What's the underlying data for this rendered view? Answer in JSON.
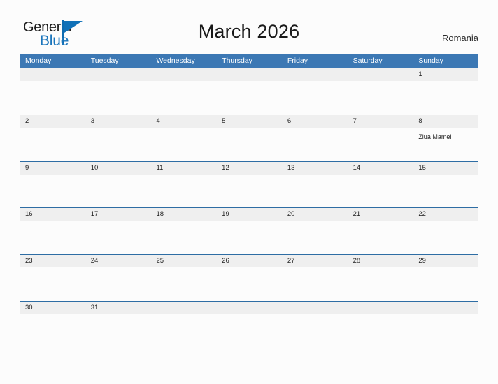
{
  "brand": {
    "word_one": "General",
    "word_two": "Blue",
    "flag_icon": "blue-triangle-flag",
    "color_dark": "#1a1a1a",
    "color_blue": "#1b75bb"
  },
  "header": {
    "title": "March 2026",
    "country": "Romania"
  },
  "theme": {
    "header_bar": "#3c78b4",
    "row_divider": "#2e6da4",
    "date_band": "#efefef",
    "page_background": "#fcfcfc"
  },
  "calendar": {
    "weekdays": [
      "Monday",
      "Tuesday",
      "Wednesday",
      "Thursday",
      "Friday",
      "Saturday",
      "Sunday"
    ],
    "weeks": [
      {
        "days": [
          {
            "date": "",
            "event": ""
          },
          {
            "date": "",
            "event": ""
          },
          {
            "date": "",
            "event": ""
          },
          {
            "date": "",
            "event": ""
          },
          {
            "date": "",
            "event": ""
          },
          {
            "date": "",
            "event": ""
          },
          {
            "date": "1",
            "event": ""
          }
        ]
      },
      {
        "days": [
          {
            "date": "2",
            "event": ""
          },
          {
            "date": "3",
            "event": ""
          },
          {
            "date": "4",
            "event": ""
          },
          {
            "date": "5",
            "event": ""
          },
          {
            "date": "6",
            "event": ""
          },
          {
            "date": "7",
            "event": ""
          },
          {
            "date": "8",
            "event": "Ziua Mamei"
          }
        ]
      },
      {
        "days": [
          {
            "date": "9",
            "event": ""
          },
          {
            "date": "10",
            "event": ""
          },
          {
            "date": "11",
            "event": ""
          },
          {
            "date": "12",
            "event": ""
          },
          {
            "date": "13",
            "event": ""
          },
          {
            "date": "14",
            "event": ""
          },
          {
            "date": "15",
            "event": ""
          }
        ]
      },
      {
        "days": [
          {
            "date": "16",
            "event": ""
          },
          {
            "date": "17",
            "event": ""
          },
          {
            "date": "18",
            "event": ""
          },
          {
            "date": "19",
            "event": ""
          },
          {
            "date": "20",
            "event": ""
          },
          {
            "date": "21",
            "event": ""
          },
          {
            "date": "22",
            "event": ""
          }
        ]
      },
      {
        "days": [
          {
            "date": "23",
            "event": ""
          },
          {
            "date": "24",
            "event": ""
          },
          {
            "date": "25",
            "event": ""
          },
          {
            "date": "26",
            "event": ""
          },
          {
            "date": "27",
            "event": ""
          },
          {
            "date": "28",
            "event": ""
          },
          {
            "date": "29",
            "event": ""
          }
        ]
      },
      {
        "days": [
          {
            "date": "30",
            "event": ""
          },
          {
            "date": "31",
            "event": ""
          },
          {
            "date": "",
            "event": ""
          },
          {
            "date": "",
            "event": ""
          },
          {
            "date": "",
            "event": ""
          },
          {
            "date": "",
            "event": ""
          },
          {
            "date": "",
            "event": ""
          }
        ]
      }
    ]
  }
}
